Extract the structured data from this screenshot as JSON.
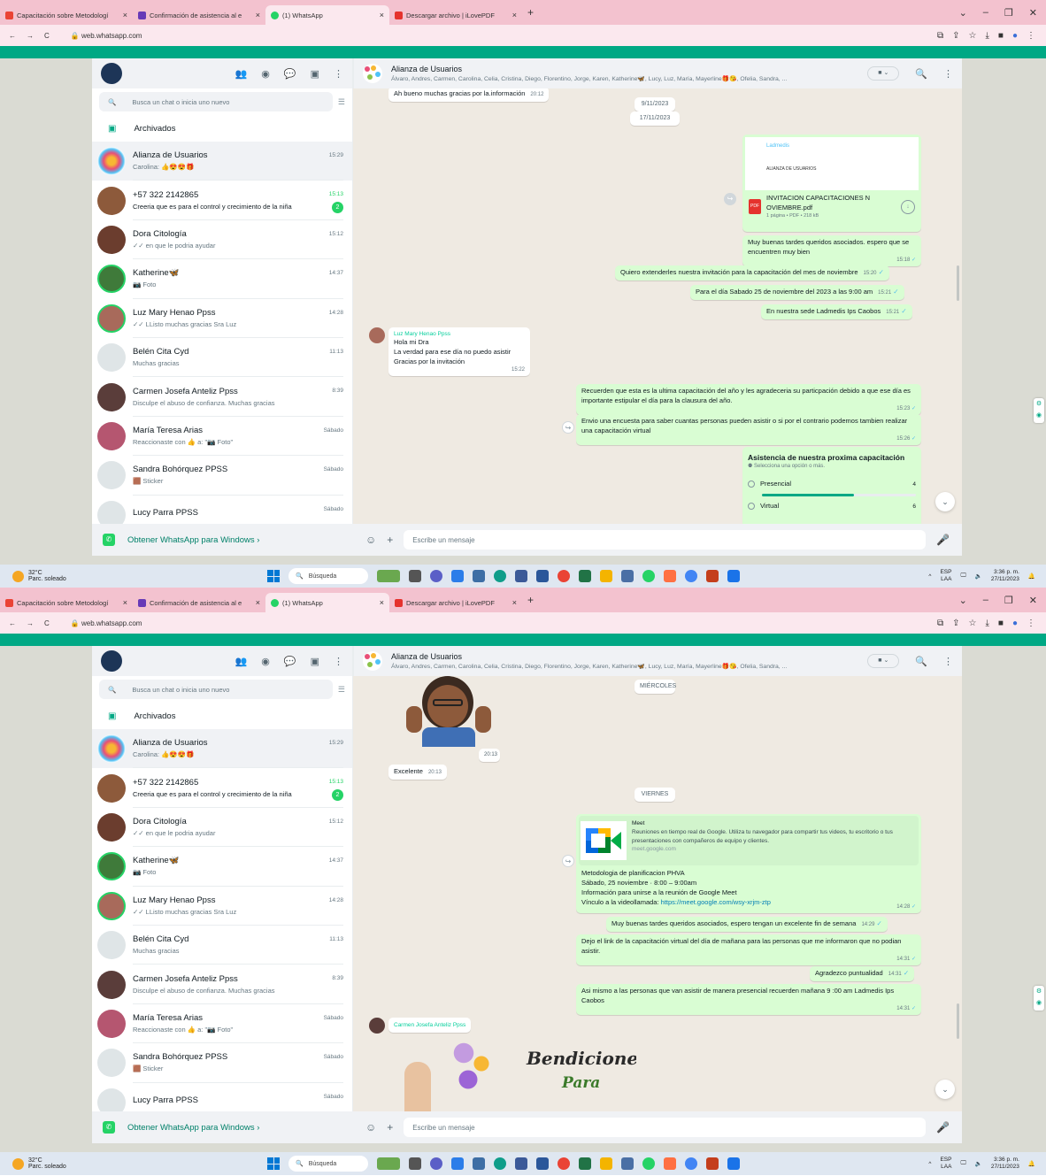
{
  "browser": {
    "tabs": [
      {
        "label": "Capacitación sobre Metodologí",
        "fav_color": "#ea4335"
      },
      {
        "label": "Confirmación de asistencia al e",
        "fav_color": "#673ab7"
      },
      {
        "label": "(1) WhatsApp",
        "fav_color": "#25d366"
      },
      {
        "label": "Descargar archivo | iLovePDF",
        "fav_color": "#e5322d"
      }
    ],
    "new_tab": "+",
    "url": "web.whatsapp.com"
  },
  "sidebar": {
    "search_placeholder": "Busca un chat o inicia uno nuevo",
    "archived": "Archivados",
    "chats": [
      {
        "name": "Alianza de Usuarios",
        "preview": "Carolina: 👍😍😍🎁",
        "time": "15:29"
      },
      {
        "name": "+57 322 2142865",
        "preview": "Creeria que es para el control y crecimiento de la niña",
        "time": "15:13",
        "unread": "2"
      },
      {
        "name": "Dora Citología",
        "preview": "✓✓ en que le podria ayudar",
        "time": "15:12"
      },
      {
        "name": "Katherine🦋",
        "preview": "📷 Foto",
        "time": "14:37"
      },
      {
        "name": "Luz Mary Henao Ppss",
        "preview": "✓✓ LListo muchas gracias Sra Luz",
        "time": "14:28"
      },
      {
        "name": "Belén Cita Cyd",
        "preview": "Muchas gracias",
        "time": "11:13"
      },
      {
        "name": "Carmen Josefa Anteliz Ppss",
        "preview": "Disculpe el abuso de confianza. Muchas gracias",
        "time": "8:39"
      },
      {
        "name": "María Teresa Arias",
        "preview": "Reaccionaste con 👍 a: \"📷 Foto\"",
        "time": "Sábado"
      },
      {
        "name": "Sandra Bohórquez PPSS",
        "preview": "🟫 Sticker",
        "time": "Sábado"
      },
      {
        "name": "Lucy Parra PPSS",
        "preview": "",
        "time": "Sábado"
      }
    ],
    "footer": "Obtener WhatsApp para Windows ›"
  },
  "group": {
    "title": "Alianza de Usuarios",
    "members": "Álvaro, Andres, Carmen, Carolina, Celia, Cristina, Diego, Florentino, Jorge, Karen, Katherine🦋, Lucy, Luz, María, Mayerline🎁😘, Ofelia, Sandra, ..."
  },
  "composer": {
    "placeholder": "Escribe un mensaje"
  },
  "screen1": {
    "m0": {
      "text": "Ah bueno muchas gracias por la.información",
      "time": "20:12"
    },
    "date1": "9/11/2023",
    "date2": "17/11/2023",
    "pdf": {
      "name": "INVITACION CAPACITACIONES N OVIEMBRE.pdf",
      "meta": "1 página • PDF • 218 kB",
      "preview_brand": "Ladmedis",
      "preview_line": "ALIANZA DE USUARIOS"
    },
    "m1": {
      "text": "Muy buenas tardes queridos asociados. espero que se encuentren muy bien",
      "time": "15:18"
    },
    "m2": {
      "text": "Quiero extenderles nuestra invitación para la capacitación del mes de noviembre",
      "time": "15:20"
    },
    "m3": {
      "text": "Para el día Sabado 25 de noviembre del 2023 a las 9:00 am",
      "time": "15:21"
    },
    "m4": {
      "text": "En nuestra sede Ladmedis Ips Caobos",
      "time": "15:21"
    },
    "in1": {
      "sender": "Luz Mary Henao Ppss",
      "l1": "Hola mi Dra",
      "l2": "La verdad para ese día no puedo asistir",
      "l3": "Gracias por la invitación",
      "time": "15:22"
    },
    "m5": {
      "text": "Recuerden que esta es la ultima capacitación del año y les agradeceria su particpación debido a que ese día es importante estipular el día para la clausura del año.",
      "time": "15:23"
    },
    "m6": {
      "text": "Envio una encuesta para saber cuantas personas pueden asistir o si por el contrario podemos tambien realizar una capacitación virtual",
      "time": "15:26"
    },
    "poll": {
      "title": "Asistencia de nuestra proxima capacitación",
      "hint": "Selecciona una opción o más.",
      "opt1": "Presencial",
      "opt1_votes": "4",
      "opt1_share": 0.6,
      "opt2": "Virtual",
      "opt2_votes": "6"
    }
  },
  "screen2": {
    "s_time": "20:13",
    "in2": {
      "text": "Excelente",
      "time": "20:13"
    },
    "day1": "MIÉRCOLES",
    "day2": "VIERNES",
    "meet": {
      "title": "Meet",
      "desc": "Reuniones en tiempo real de Google. Utiliza tu navegador para compartir tus videos, tu escritorio o tus presentaciones con compañeros de equipo y clientes.",
      "domain": "meet.google.com",
      "l1": "Metodologia de planificacion PHVA",
      "l2": "Sábado, 25 noviembre · 8:00 – 9:00am",
      "l3": "Información para unirse a la reunión de Google Meet",
      "l4": "Vínculo a la videollamada:",
      "link": "https://meet.google.com/wsy-xrjm-ztp",
      "time": "14:28"
    },
    "m7": {
      "text": "Muy buenas tardes queridos asociados, espero tengan un excelente fin de semana",
      "time": "14:29"
    },
    "m8": {
      "text": "Dejo el link de la capacitación virtual  del día de mañana para las personas que me informaron que no podian asistir.",
      "time": "14:31"
    },
    "m9": {
      "text": "Agradezco puntualidad",
      "time": "14:31"
    },
    "m10": {
      "text": "Asi mismo  a las personas que van asistir de manera presencial recuerden mañana 9 :00 am Ladmedis Ips Caobos",
      "time": "14:31"
    },
    "in3": {
      "sender": "Carmen Josefa Anteliz Ppss"
    },
    "sticker_text": "Bendiciones",
    "sticker_text2": "Para"
  },
  "taskbar": {
    "temp": "32°C",
    "weather": "Parc. soleado",
    "search": "Búsqueda",
    "lang1": "ESP",
    "lang2": "LAA",
    "time": "3:36 p. m.",
    "date": "27/11/2023"
  }
}
